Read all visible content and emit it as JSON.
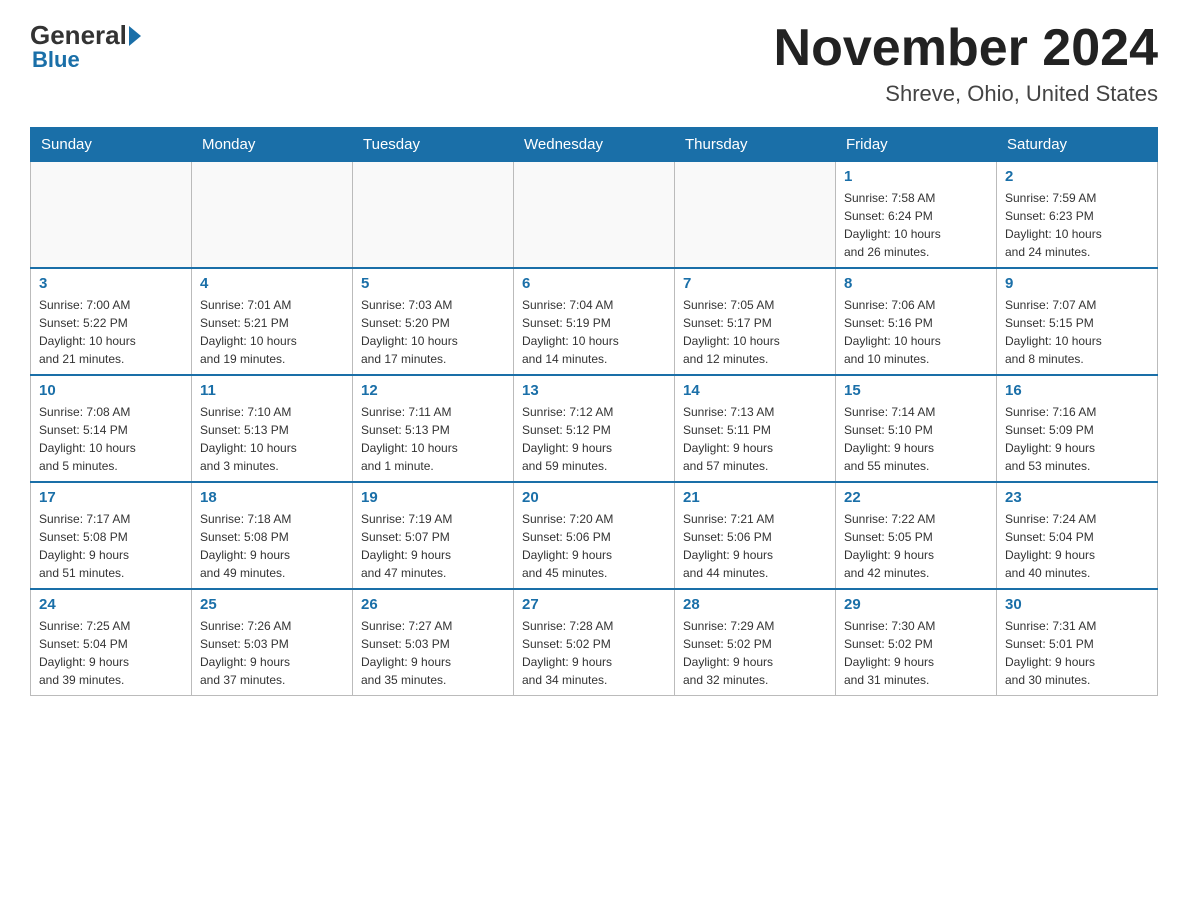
{
  "header": {
    "logo_general": "General",
    "logo_blue": "Blue",
    "month_title": "November 2024",
    "location": "Shreve, Ohio, United States"
  },
  "weekdays": [
    "Sunday",
    "Monday",
    "Tuesday",
    "Wednesday",
    "Thursday",
    "Friday",
    "Saturday"
  ],
  "weeks": [
    [
      {
        "day": "",
        "info": ""
      },
      {
        "day": "",
        "info": ""
      },
      {
        "day": "",
        "info": ""
      },
      {
        "day": "",
        "info": ""
      },
      {
        "day": "",
        "info": ""
      },
      {
        "day": "1",
        "info": "Sunrise: 7:58 AM\nSunset: 6:24 PM\nDaylight: 10 hours\nand 26 minutes."
      },
      {
        "day": "2",
        "info": "Sunrise: 7:59 AM\nSunset: 6:23 PM\nDaylight: 10 hours\nand 24 minutes."
      }
    ],
    [
      {
        "day": "3",
        "info": "Sunrise: 7:00 AM\nSunset: 5:22 PM\nDaylight: 10 hours\nand 21 minutes."
      },
      {
        "day": "4",
        "info": "Sunrise: 7:01 AM\nSunset: 5:21 PM\nDaylight: 10 hours\nand 19 minutes."
      },
      {
        "day": "5",
        "info": "Sunrise: 7:03 AM\nSunset: 5:20 PM\nDaylight: 10 hours\nand 17 minutes."
      },
      {
        "day": "6",
        "info": "Sunrise: 7:04 AM\nSunset: 5:19 PM\nDaylight: 10 hours\nand 14 minutes."
      },
      {
        "day": "7",
        "info": "Sunrise: 7:05 AM\nSunset: 5:17 PM\nDaylight: 10 hours\nand 12 minutes."
      },
      {
        "day": "8",
        "info": "Sunrise: 7:06 AM\nSunset: 5:16 PM\nDaylight: 10 hours\nand 10 minutes."
      },
      {
        "day": "9",
        "info": "Sunrise: 7:07 AM\nSunset: 5:15 PM\nDaylight: 10 hours\nand 8 minutes."
      }
    ],
    [
      {
        "day": "10",
        "info": "Sunrise: 7:08 AM\nSunset: 5:14 PM\nDaylight: 10 hours\nand 5 minutes."
      },
      {
        "day": "11",
        "info": "Sunrise: 7:10 AM\nSunset: 5:13 PM\nDaylight: 10 hours\nand 3 minutes."
      },
      {
        "day": "12",
        "info": "Sunrise: 7:11 AM\nSunset: 5:13 PM\nDaylight: 10 hours\nand 1 minute."
      },
      {
        "day": "13",
        "info": "Sunrise: 7:12 AM\nSunset: 5:12 PM\nDaylight: 9 hours\nand 59 minutes."
      },
      {
        "day": "14",
        "info": "Sunrise: 7:13 AM\nSunset: 5:11 PM\nDaylight: 9 hours\nand 57 minutes."
      },
      {
        "day": "15",
        "info": "Sunrise: 7:14 AM\nSunset: 5:10 PM\nDaylight: 9 hours\nand 55 minutes."
      },
      {
        "day": "16",
        "info": "Sunrise: 7:16 AM\nSunset: 5:09 PM\nDaylight: 9 hours\nand 53 minutes."
      }
    ],
    [
      {
        "day": "17",
        "info": "Sunrise: 7:17 AM\nSunset: 5:08 PM\nDaylight: 9 hours\nand 51 minutes."
      },
      {
        "day": "18",
        "info": "Sunrise: 7:18 AM\nSunset: 5:08 PM\nDaylight: 9 hours\nand 49 minutes."
      },
      {
        "day": "19",
        "info": "Sunrise: 7:19 AM\nSunset: 5:07 PM\nDaylight: 9 hours\nand 47 minutes."
      },
      {
        "day": "20",
        "info": "Sunrise: 7:20 AM\nSunset: 5:06 PM\nDaylight: 9 hours\nand 45 minutes."
      },
      {
        "day": "21",
        "info": "Sunrise: 7:21 AM\nSunset: 5:06 PM\nDaylight: 9 hours\nand 44 minutes."
      },
      {
        "day": "22",
        "info": "Sunrise: 7:22 AM\nSunset: 5:05 PM\nDaylight: 9 hours\nand 42 minutes."
      },
      {
        "day": "23",
        "info": "Sunrise: 7:24 AM\nSunset: 5:04 PM\nDaylight: 9 hours\nand 40 minutes."
      }
    ],
    [
      {
        "day": "24",
        "info": "Sunrise: 7:25 AM\nSunset: 5:04 PM\nDaylight: 9 hours\nand 39 minutes."
      },
      {
        "day": "25",
        "info": "Sunrise: 7:26 AM\nSunset: 5:03 PM\nDaylight: 9 hours\nand 37 minutes."
      },
      {
        "day": "26",
        "info": "Sunrise: 7:27 AM\nSunset: 5:03 PM\nDaylight: 9 hours\nand 35 minutes."
      },
      {
        "day": "27",
        "info": "Sunrise: 7:28 AM\nSunset: 5:02 PM\nDaylight: 9 hours\nand 34 minutes."
      },
      {
        "day": "28",
        "info": "Sunrise: 7:29 AM\nSunset: 5:02 PM\nDaylight: 9 hours\nand 32 minutes."
      },
      {
        "day": "29",
        "info": "Sunrise: 7:30 AM\nSunset: 5:02 PM\nDaylight: 9 hours\nand 31 minutes."
      },
      {
        "day": "30",
        "info": "Sunrise: 7:31 AM\nSunset: 5:01 PM\nDaylight: 9 hours\nand 30 minutes."
      }
    ]
  ]
}
